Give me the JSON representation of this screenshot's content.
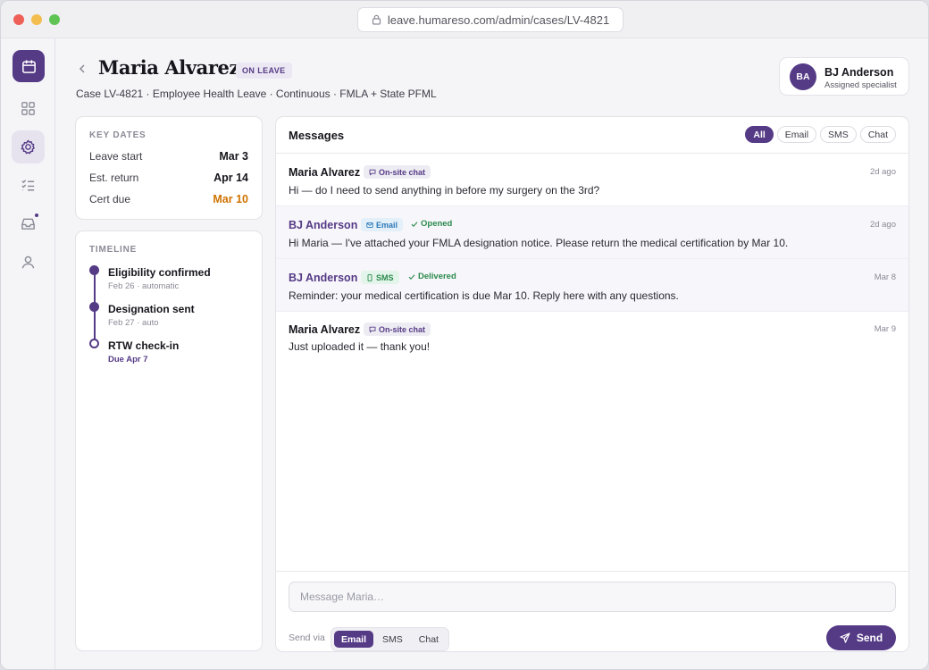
{
  "browser": {
    "url": "leave.humareso.com/admin/cases/LV-4821"
  },
  "sidebar": {
    "items": [
      {
        "icon": "calendar-icon"
      },
      {
        "icon": "grid-icon"
      },
      {
        "icon": "gear-icon"
      },
      {
        "icon": "checklist-icon"
      },
      {
        "icon": "inbox-icon"
      },
      {
        "icon": "user-icon"
      }
    ]
  },
  "header": {
    "title": "Maria Alvarez",
    "status": "ON LEAVE",
    "subtitle": "Case LV-4821 · Employee Health Leave · Continuous · FMLA + State PFML",
    "assignee": {
      "initials": "BA",
      "name": "BJ Anderson",
      "role": "Assigned specialist"
    }
  },
  "key_dates": {
    "heading": "KEY DATES",
    "rows": [
      {
        "label": "Leave start",
        "value": "Mar 3"
      },
      {
        "label": "Est. return",
        "value": "Apr 14"
      },
      {
        "label": "Cert due",
        "value": "Mar 10"
      }
    ]
  },
  "timeline": {
    "heading": "TIMELINE",
    "items": [
      {
        "title": "Eligibility confirmed",
        "meta": "Feb 26 · automatic",
        "done": true
      },
      {
        "title": "Designation sent",
        "meta": "Feb 27 · auto",
        "done": true
      },
      {
        "title": "RTW check-in",
        "meta": "Due Apr 7",
        "done": false
      }
    ]
  },
  "messages": {
    "title": "Messages",
    "filters": [
      "All",
      "Email",
      "SMS",
      "Chat"
    ],
    "active_filter": "All",
    "items": [
      {
        "sender": "Maria Alvarez",
        "channel": "On-site chat",
        "status": "",
        "time": "2d ago",
        "body": "Hi — do I need to send anything in before my surgery on the 3rd?"
      },
      {
        "sender": "BJ Anderson",
        "channel": "Email",
        "status": "Opened",
        "time": "2d ago",
        "body": "Hi Maria — I've attached your FMLA designation notice. Please return the medical certification by Mar 10."
      },
      {
        "sender": "BJ Anderson",
        "channel": "SMS",
        "status": "Delivered",
        "time": "Mar 8",
        "body": "Reminder: your medical certification is due Mar 10. Reply here with any questions."
      },
      {
        "sender": "Maria Alvarez",
        "channel": "On-site chat",
        "status": "",
        "time": "Mar 9",
        "body": "Just uploaded it — thank you!"
      }
    ]
  },
  "composer": {
    "placeholder": "Message Maria…",
    "send_via_label": "Send via",
    "channels": [
      "Email",
      "SMS",
      "Chat"
    ],
    "active_channel": "Email",
    "send_label": "Send"
  },
  "colors": {
    "brand": "#553a86",
    "warning": "#cf7300",
    "success": "#2b8a4d",
    "email": "#2c78b6"
  }
}
